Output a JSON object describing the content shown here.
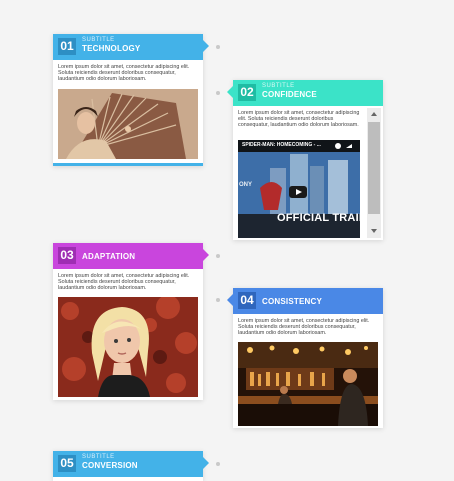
{
  "cards": [
    {
      "number": "01",
      "subtitle": "subtitle",
      "title": "TECHNOLOGY",
      "text": "Lorem ipsum dolor sit amet, consectetur adipiscing elit. Soluta reiciendis deserunt doloribus consequatur, laudantium odio dolorum laboriosam.",
      "color": "#43b2e8",
      "media": "image: woman with ornate fan"
    },
    {
      "number": "02",
      "subtitle": "subtitle",
      "title": "CONFIDENCE",
      "text": "Lorem ipsum dolor sit amet, consectetur adipiscing elit. Soluta reiciendis deserunt doloribus consequatur, laudantium odio dolorum laboriosam.",
      "color": "#3be3c8",
      "video": {
        "title": "SPIDER-MAN: HOMECOMING - ...",
        "overlay": "OFFICIAL TRAILER",
        "brand": "ONY"
      }
    },
    {
      "number": "03",
      "title": "ADAPTATION",
      "text": "Lorem ipsum dolor sit amet, consectetur adipiscing elit. Soluta reiciendis deserunt doloribus consequatur, laudantium odio dolorum laboriosam.",
      "color": "#c945dd",
      "media": "image: blonde woman with red leaves"
    },
    {
      "number": "04",
      "title": "CONSISTENCY",
      "text": "Lorem ipsum dolor sit amet, consectetur adipiscing elit. Soluta reiciendis deserunt doloribus consequatur, laudantium odio dolorum laboriosam.",
      "color": "#4a88e6",
      "media": "image: busy bar interior"
    },
    {
      "number": "05",
      "subtitle": "subtitle",
      "title": "CONVERSION",
      "color": "#43b2e8"
    }
  ]
}
